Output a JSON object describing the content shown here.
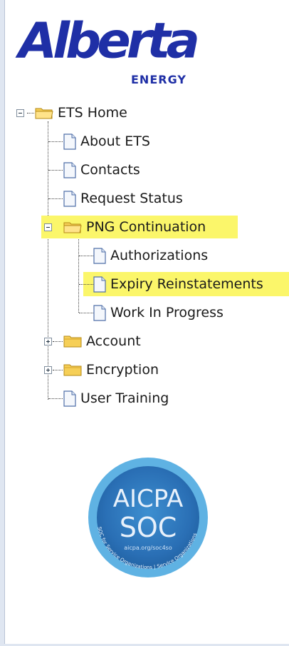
{
  "logo": {
    "word": "Alberta",
    "sub": "ENERGY"
  },
  "tree": {
    "root": {
      "label": "ETS Home",
      "icon": "folder-open-icon"
    },
    "items": [
      {
        "label": "About ETS",
        "icon": "page-icon"
      },
      {
        "label": "Contacts",
        "icon": "page-icon"
      },
      {
        "label": "Request Status",
        "icon": "page-icon"
      },
      {
        "label": "PNG Continuation",
        "icon": "folder-open-icon",
        "highlighted": true,
        "children": [
          {
            "label": "Authorizations",
            "icon": "page-icon"
          },
          {
            "label": "Expiry Reinstatements",
            "icon": "page-icon",
            "selected": true
          },
          {
            "label": "Work In Progress",
            "icon": "page-icon"
          }
        ]
      },
      {
        "label": "Account",
        "icon": "folder-closed-icon"
      },
      {
        "label": "Encryption",
        "icon": "folder-closed-icon"
      },
      {
        "label": "User Training",
        "icon": "page-icon"
      }
    ]
  },
  "badge": {
    "title": "AICPA",
    "subtitle": "SOC",
    "url": "aicpa.org/soc4so",
    "ring_text": "SOC for Service Organizations | Service Organizations"
  },
  "colors": {
    "brand_blue": "#1f2fa6",
    "highlight": "#fbf66a",
    "badge_blue": "#2f7fc0",
    "badge_cyan": "#5fb2e3"
  }
}
